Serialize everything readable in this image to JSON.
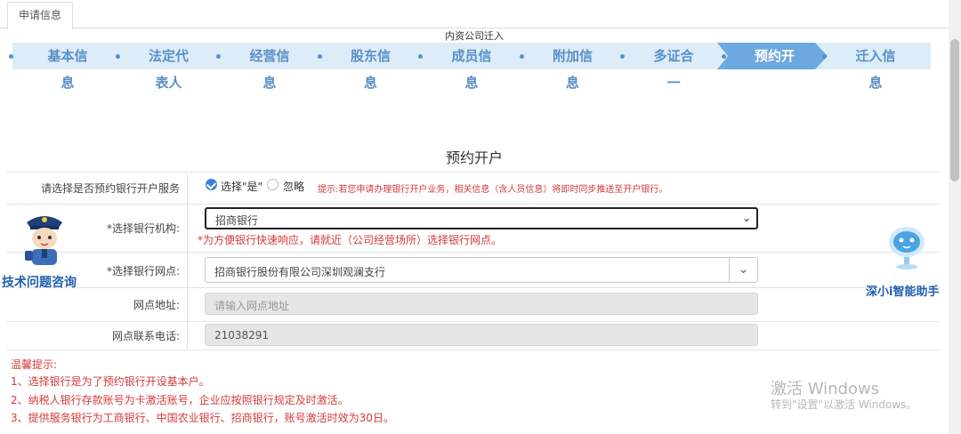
{
  "tabs": [
    {
      "label": "申请信息"
    }
  ],
  "flow_title": "内资公司迁入",
  "steps": [
    {
      "line1": "基本信",
      "line2": "息"
    },
    {
      "line1": "法定代",
      "line2": "表人"
    },
    {
      "line1": "经营信",
      "line2": "息"
    },
    {
      "line1": "股东信",
      "line2": "息"
    },
    {
      "line1": "成员信",
      "line2": "息"
    },
    {
      "line1": "附加信",
      "line2": "息"
    },
    {
      "line1": "多证合",
      "line2": "一"
    },
    {
      "line1": "预约开",
      "line2": ""
    },
    {
      "line1": "迁入信",
      "line2": "息"
    }
  ],
  "active_step_index": 7,
  "section_title": "预约开户",
  "form": {
    "service_label": "请选择是否预约银行开户服务",
    "option_yes": "选择\"是\"",
    "option_ignore": "忽略",
    "service_hint": "提示:若您申请办理银行开户业务，相关信息（含人员信息）将即时同步推送至开户银行。",
    "bank_label": "*选择银行机构:",
    "bank_value": "招商银行",
    "bank_hint": "*为方便银行快速响应，请就近（公司经营场所）选择银行网点。",
    "branch_label": "*选择银行网点:",
    "branch_value": "招商银行股份有限公司深圳观澜支行",
    "address_label": "网点地址:",
    "address_placeholder": "请输入网点地址",
    "phone_label": "网点联系电话:",
    "phone_value": "21038291"
  },
  "tips": {
    "title": "温馨提示:",
    "items": [
      "1、选择银行是为了预约银行开设基本户。",
      "2、纳税人银行存款账号为卡激活账号，企业应按照银行规定及时激活。",
      "3、提供服务银行为工商银行、中国农业银行、招商银行，账号激活时效为30日。"
    ]
  },
  "assistants": {
    "left_label": "技术问题咨询",
    "right_label": "深小i智能助手"
  },
  "watermark": {
    "line1": "激活 Windows",
    "line2": "转到\"设置\"以激活 Windows。"
  },
  "colors": {
    "step_band": "#dcecf8",
    "step_active": "#6ea8e0",
    "step_text": "#5b8fc7",
    "hint_red": "#d43a3a",
    "radio_blue": "#3b82d6"
  }
}
